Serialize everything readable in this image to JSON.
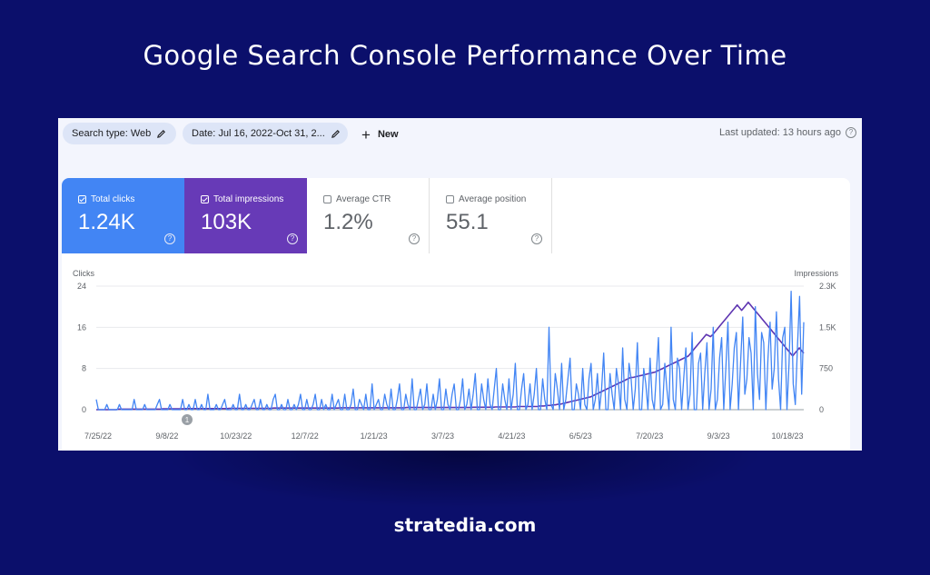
{
  "page": {
    "title": "Google Search Console Performance Over Time",
    "brand": "stratedia.com"
  },
  "filters": {
    "search_type": "Search type: Web",
    "date": "Date: Jul 16, 2022-Oct 31, 2...",
    "new_label": "New",
    "last_updated": "Last updated: 13 hours ago"
  },
  "metrics": [
    {
      "label": "Total clicks",
      "value": "1.24K",
      "selected": true,
      "color": "#4285f4"
    },
    {
      "label": "Total impressions",
      "value": "103K",
      "selected": true,
      "color": "#673ab7"
    },
    {
      "label": "Average CTR",
      "value": "1.2%",
      "selected": false
    },
    {
      "label": "Average position",
      "value": "55.1",
      "selected": false
    }
  ],
  "chart_data": {
    "type": "line",
    "x_tick_labels": [
      "7/25/22",
      "9/8/22",
      "10/23/22",
      "12/7/22",
      "1/21/23",
      "3/7/23",
      "4/21/23",
      "6/5/23",
      "7/20/23",
      "9/3/23",
      "10/18/23"
    ],
    "left_axis": {
      "label": "Clicks",
      "ticks": [
        "0",
        "8",
        "16",
        "24"
      ],
      "ylim": [
        0,
        24
      ]
    },
    "right_axis": {
      "label": "Impressions",
      "ticks": [
        "0",
        "750",
        "1.5K",
        "2.3K"
      ],
      "ylim": [
        0,
        2300
      ]
    },
    "annotation": "1",
    "grid": true,
    "series": [
      {
        "name": "Total clicks",
        "axis": "left",
        "color": "#4285f4",
        "values": [
          2,
          0,
          0,
          0,
          0,
          1,
          0,
          0,
          0,
          0,
          0,
          1,
          0,
          0,
          0,
          0,
          0,
          0,
          2,
          0,
          0,
          0,
          0,
          1,
          0,
          0,
          0,
          0,
          0,
          1,
          2,
          0,
          0,
          0,
          0,
          1,
          0,
          0,
          0,
          0,
          0,
          2,
          0,
          0,
          1,
          0,
          0,
          2,
          0,
          0,
          1,
          0,
          0,
          3,
          0,
          0,
          0,
          1,
          0,
          0,
          1,
          2,
          0,
          0,
          0,
          1,
          0,
          0,
          3,
          0,
          0,
          1,
          0,
          0,
          1,
          2,
          0,
          0,
          2,
          0,
          0,
          1,
          0,
          0,
          2,
          3,
          0,
          0,
          1,
          0,
          0,
          2,
          0,
          0,
          1,
          0,
          1,
          3,
          0,
          0,
          2,
          0,
          0,
          1,
          3,
          0,
          0,
          2,
          0,
          1,
          0,
          0,
          3,
          0,
          1,
          2,
          0,
          0,
          3,
          0,
          0,
          1,
          4,
          0,
          0,
          2,
          1,
          0,
          3,
          0,
          0,
          5,
          0,
          1,
          2,
          0,
          0,
          3,
          1,
          0,
          4,
          0,
          0,
          2,
          5,
          0,
          0,
          3,
          1,
          0,
          6,
          0,
          0,
          2,
          4,
          0,
          1,
          5,
          0,
          0,
          3,
          0,
          2,
          6,
          0,
          0,
          4,
          1,
          0,
          3,
          5,
          0,
          0,
          2,
          6,
          0,
          1,
          4,
          0,
          3,
          7,
          0,
          0,
          5,
          2,
          0,
          6,
          1,
          0,
          4,
          8,
          0,
          0,
          5,
          2,
          0,
          6,
          0,
          3,
          9,
          0,
          0,
          4,
          7,
          0,
          1,
          5,
          0,
          3,
          8,
          0,
          0,
          6,
          2,
          0,
          16,
          1,
          0,
          7,
          4,
          0,
          9,
          0,
          2,
          6,
          10,
          0,
          0,
          5,
          3,
          0,
          8,
          1,
          0,
          6,
          9,
          0,
          2,
          7,
          0,
          4,
          11,
          0,
          0,
          7,
          3,
          0,
          8,
          5,
          0,
          12,
          2,
          0,
          9,
          6,
          0,
          4,
          13,
          0,
          0,
          8,
          5,
          0,
          10,
          2,
          0,
          7,
          14,
          0,
          1,
          9,
          4,
          0,
          16,
          2,
          0,
          10,
          8,
          0,
          6,
          12,
          0,
          3,
          15,
          0,
          0,
          9,
          11,
          0,
          7,
          13,
          0,
          4,
          16,
          0,
          2,
          10,
          14,
          0,
          8,
          17,
          0,
          5,
          12,
          15,
          0,
          9,
          18,
          3,
          6,
          14,
          11,
          0,
          20,
          7,
          2,
          15,
          13,
          0,
          10,
          17,
          4,
          8,
          19,
          6,
          0,
          14,
          16,
          0,
          9,
          23,
          5,
          1,
          12,
          22,
          3,
          17
        ]
      },
      {
        "name": "Total impressions",
        "axis": "right",
        "color": "#5e35b1",
        "values": [
          0,
          0,
          0,
          0,
          0,
          0,
          0,
          0,
          0,
          0,
          10,
          10,
          10,
          10,
          10,
          10,
          10,
          10,
          10,
          10,
          10,
          10,
          10,
          10,
          10,
          10,
          10,
          10,
          10,
          10,
          15,
          15,
          15,
          15,
          15,
          15,
          15,
          15,
          15,
          15,
          20,
          20,
          20,
          20,
          20,
          20,
          20,
          20,
          20,
          20,
          20,
          20,
          20,
          20,
          20,
          20,
          20,
          20,
          20,
          20,
          25,
          25,
          25,
          25,
          25,
          25,
          25,
          25,
          25,
          25,
          25,
          25,
          25,
          25,
          25,
          25,
          25,
          25,
          25,
          25,
          30,
          30,
          30,
          30,
          30,
          30,
          30,
          30,
          30,
          30,
          30,
          30,
          30,
          30,
          30,
          30,
          30,
          30,
          30,
          30,
          30,
          30,
          30,
          30,
          30,
          30,
          30,
          30,
          30,
          30,
          35,
          35,
          35,
          35,
          35,
          35,
          35,
          35,
          35,
          35,
          35,
          35,
          35,
          35,
          35,
          35,
          35,
          35,
          35,
          35,
          35,
          35,
          35,
          35,
          35,
          35,
          35,
          35,
          35,
          35,
          40,
          40,
          40,
          40,
          40,
          40,
          40,
          40,
          40,
          40,
          40,
          40,
          40,
          40,
          40,
          40,
          40,
          40,
          40,
          40,
          40,
          40,
          40,
          40,
          40,
          40,
          40,
          40,
          40,
          40,
          45,
          45,
          45,
          45,
          45,
          45,
          45,
          45,
          45,
          45,
          50,
          50,
          50,
          50,
          50,
          50,
          50,
          50,
          50,
          50,
          60,
          60,
          60,
          60,
          60,
          60,
          60,
          60,
          60,
          60,
          70,
          70,
          70,
          80,
          80,
          80,
          90,
          90,
          100,
          100,
          110,
          120,
          130,
          140,
          150,
          160,
          170,
          180,
          190,
          200,
          210,
          220,
          230,
          240,
          260,
          280,
          300,
          320,
          340,
          360,
          380,
          400,
          420,
          440,
          460,
          480,
          500,
          520,
          540,
          560,
          580,
          600,
          600,
          610,
          620,
          630,
          640,
          650,
          660,
          670,
          680,
          690,
          700,
          720,
          740,
          760,
          780,
          800,
          820,
          840,
          860,
          880,
          900,
          920,
          940,
          960,
          980,
          1000,
          1050,
          1100,
          1150,
          1200,
          1250,
          1300,
          1350,
          1400,
          1380,
          1360,
          1400,
          1450,
          1500,
          1550,
          1600,
          1650,
          1700,
          1750,
          1800,
          1850,
          1900,
          1950,
          1900,
          1850,
          1900,
          1950,
          2000,
          1950,
          1900,
          1850,
          1800,
          1750,
          1700,
          1650,
          1600,
          1550,
          1500,
          1450,
          1400,
          1350,
          1300,
          1250,
          1200,
          1150,
          1100,
          1050,
          1000,
          1050,
          1100,
          1150,
          1100,
          1050
        ]
      }
    ]
  }
}
